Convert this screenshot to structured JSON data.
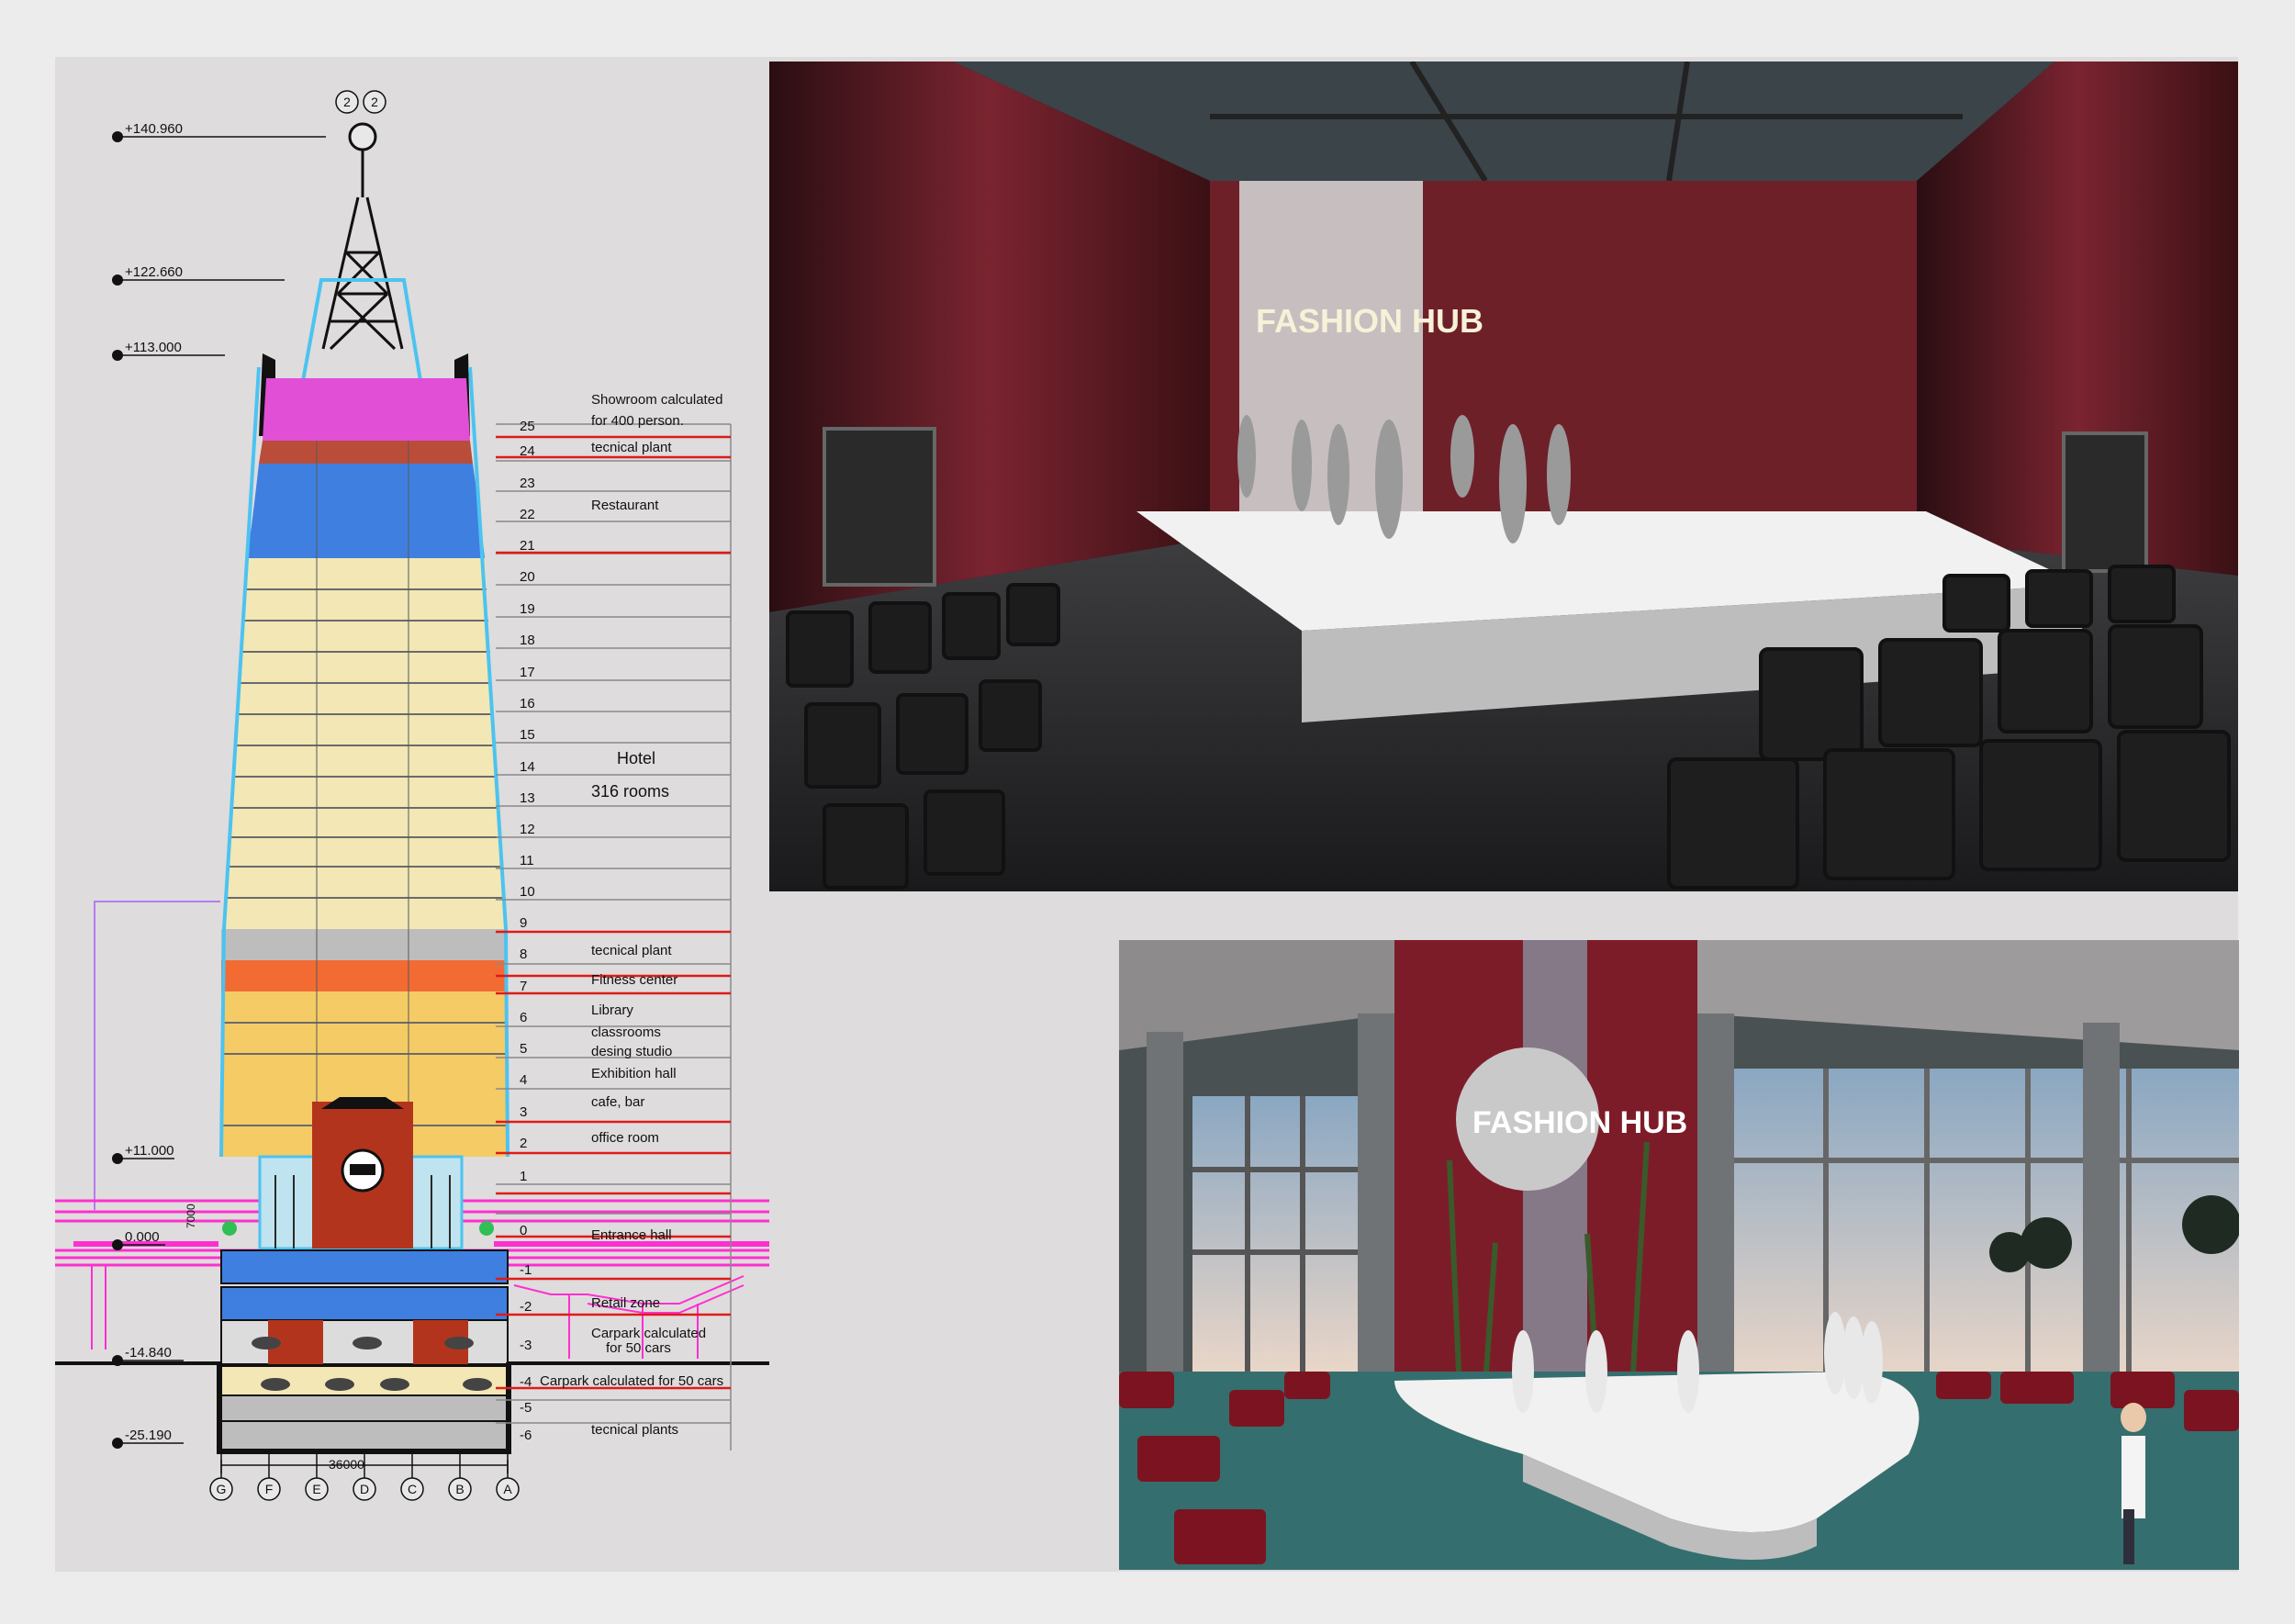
{
  "elevations": [
    "+140.960",
    "+122.660",
    "+113.000",
    "+11.000",
    "0.000",
    "-14.840",
    "-25.190"
  ],
  "grid_top": [
    "2",
    "2"
  ],
  "grid_axes": [
    "G",
    "F",
    "E",
    "D",
    "C",
    "B",
    "A"
  ],
  "dimension_width": "36000",
  "dimension_height": "7000",
  "floor_numbers": [
    "25",
    "24",
    "23",
    "22",
    "21",
    "20",
    "19",
    "18",
    "17",
    "16",
    "15",
    "14",
    "13",
    "12",
    "11",
    "10",
    "9",
    "8",
    "7",
    "6",
    "5",
    "4",
    "3",
    "2",
    "1",
    "0",
    "-1",
    "-2",
    "-3",
    "-4",
    "-5",
    "-6"
  ],
  "labels": {
    "showroom_1": "Showroom calculated",
    "showroom_2": "for 400 person.",
    "tech_plant_top": "tecnical plant",
    "restaurant": "Restaurant",
    "hotel": "Hotel",
    "hotel_rooms": "316 rooms",
    "tech_plant_mid": "tecnical plant",
    "fitness": "Fitness center",
    "library": "Library",
    "classrooms": "classrooms",
    "design_studio": "desing studio",
    "exhibition": "Exhibition hall",
    "cafe": "cafe, bar",
    "office": "office room",
    "entrance": "Entrance hall",
    "retail": "Retail zone",
    "carpark50_1": "Carpark calculated",
    "carpark50_2": "for 50 cars",
    "carpark50_row": "Carpark calculated for 50 cars",
    "tech_plants_bottom": "tecnical plants"
  },
  "renders": {
    "top_sign": "FASHION HUB",
    "bottom_sign": "FASHION HUB"
  },
  "colors": {
    "magenta": "#e04fd6",
    "blue": "#3f7fe0",
    "cream": "#f2e7b5",
    "yellow": "#f5cb66",
    "orange": "#f26b33",
    "grey": "#bdbdbd",
    "red_line": "#e01a1a",
    "pink_line": "#ff2fd0",
    "brick": "#b3341d",
    "cyan": "#4cc3f0"
  }
}
